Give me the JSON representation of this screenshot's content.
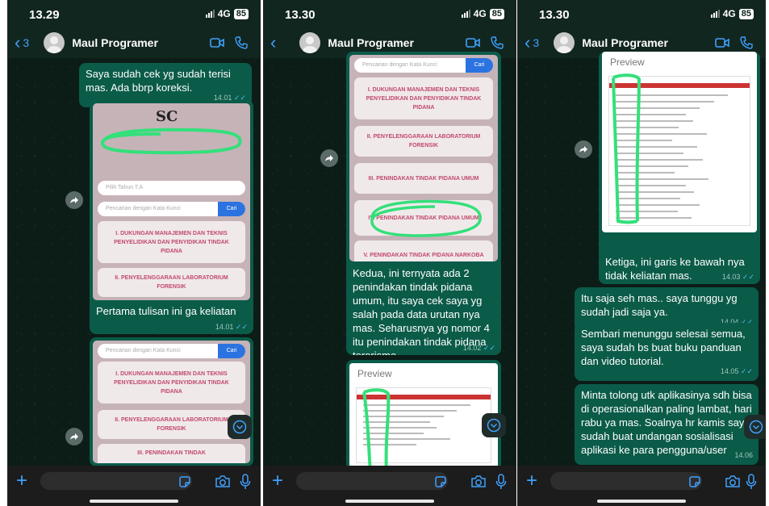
{
  "screens": [
    {
      "status": {
        "time": "13.29",
        "network": "4G",
        "battery": "85"
      },
      "header": {
        "back_count": "3",
        "contact_name": "Maul Programer"
      },
      "messages": [
        {
          "text": "Saya sudah cek yg sudah terisi mas. Ada bbrp koreksi.",
          "time": "14.01"
        },
        {
          "text": "Pertama tulisan ini ga keliatan",
          "time": "14.01"
        }
      ],
      "screenshot_a": {
        "logo_text": "SC",
        "year_placeholder": "Pilih Tahun T.A",
        "search_placeholder": "Pencarian dengan Kata Kunci",
        "search_button": "Cari",
        "cards": [
          "I. DUKUNGAN MANAJEMEN DAN TEKNIS PENYELIDIKAN DAN PENYIDIKAN TINDAK PIDANA",
          "II. PENYELENGGARAAN LABORATORIUM FORENSIK"
        ]
      },
      "screenshot_b": {
        "search_placeholder": "Pencarian dengan Kata Kunci",
        "search_button": "Cari",
        "cards": [
          "I. DUKUNGAN MANAJEMEN DAN TEKNIS PENYELIDIKAN DAN PENYIDIKAN TINDAK PIDANA",
          "II. PENYELENGGARAAN LABORATORIUM FORENSIK",
          "III. PENINDAKAN TINDAK"
        ]
      }
    },
    {
      "status": {
        "time": "13.30",
        "network": "4G",
        "battery": "85"
      },
      "header": {
        "back_count": "",
        "contact_name": "Maul Programer"
      },
      "screenshot_c": {
        "search_placeholder": "Pencarian dengan Kata Kunci",
        "search_button": "Cari",
        "cards": [
          "I. DUKUNGAN MANAJEMEN DAN TEKNIS PENYELIDIKAN DAN PENYIDIKAN TINDAK PIDANA",
          "II. PENYELENGGARAAN LABORATORIUM FORENSIK",
          "III. PENINDAKAN TINDAK PIDANA UMUM",
          "IV. PENINDAKAN TINDAK PIDANA UMUM",
          "V. PENINDAKAN TINDAK PIDANA NARKOBA"
        ]
      },
      "messages": [
        {
          "text": "Kedua, ini ternyata ada 2 penindakan tindak pidana umum, itu saya cek saya yg salah pada data urutan nya mas. Seharusnya yg nomor 4 itu penindakan tindak pidana terorisme",
          "time": "14.02"
        }
      ],
      "preview_title": "Preview"
    },
    {
      "status": {
        "time": "13.30",
        "network": "4G",
        "battery": "85"
      },
      "header": {
        "back_count": "3",
        "contact_name": "Maul Programer"
      },
      "preview_title": "Preview",
      "messages": [
        {
          "text": "Ketiga, ini garis ke bawah nya tidak keliatan mas.",
          "time": "14.03"
        },
        {
          "text": "Itu saja seh mas.. saya tunggu yg sudah jadi saja ya.",
          "time": "14.04"
        },
        {
          "text": "Sembari menunggu selesai semua, saya sudah bs buat buku panduan dan video tutorial.",
          "time": "14.05"
        },
        {
          "text": "Minta tolong utk aplikasinya sdh bisa di operasionalkan paling lambat, hari rabu ya mas. Soalnya hr kamis saya sudah buat undangan sosialisasi aplikasi ke para pengguna/user",
          "time": "14.06"
        }
      ]
    }
  ],
  "colors": {
    "bubble": "#0b5b49",
    "accent": "#3fa2ff",
    "highlight": "#33e07a",
    "read_tick": "#53bdeb",
    "card_text": "#c14a6b"
  },
  "icons": [
    "back-chevron-icon",
    "video-call-icon",
    "phone-call-icon",
    "forward-icon",
    "scroll-down-icon",
    "plus-icon",
    "sticker-icon",
    "camera-icon",
    "microphone-icon"
  ]
}
